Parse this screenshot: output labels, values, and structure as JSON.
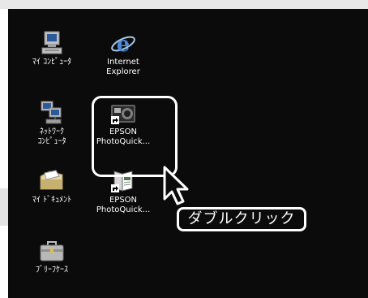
{
  "desktop": {
    "icons": [
      {
        "label": "ﾏｲ ｺﾝﾋﾟｭｰﾀ",
        "icon": "my-computer-icon"
      },
      {
        "label": "Internet\nExplorer",
        "icon": "internet-explorer-icon"
      },
      {
        "label": "ﾈｯﾄﾜｰｸ\nｺﾝﾋﾟｭｰﾀ",
        "icon": "network-computer-icon"
      },
      {
        "label": "EPSON\nPhotoQuick...",
        "icon": "epson-photoquick-camera-icon"
      },
      {
        "label": "ﾏｲ ﾄﾞｷｭﾒﾝﾄ",
        "icon": "my-documents-icon"
      },
      {
        "label": "EPSON\nPhotoQuick...",
        "icon": "epson-photoquick-book-icon"
      },
      {
        "label": "ﾌﾞﾘｰﾌｹｰｽ",
        "icon": "briefcase-icon"
      }
    ]
  },
  "annotation": {
    "callout_text": "ダブルクリック",
    "highlight_color": "#ffffff"
  }
}
